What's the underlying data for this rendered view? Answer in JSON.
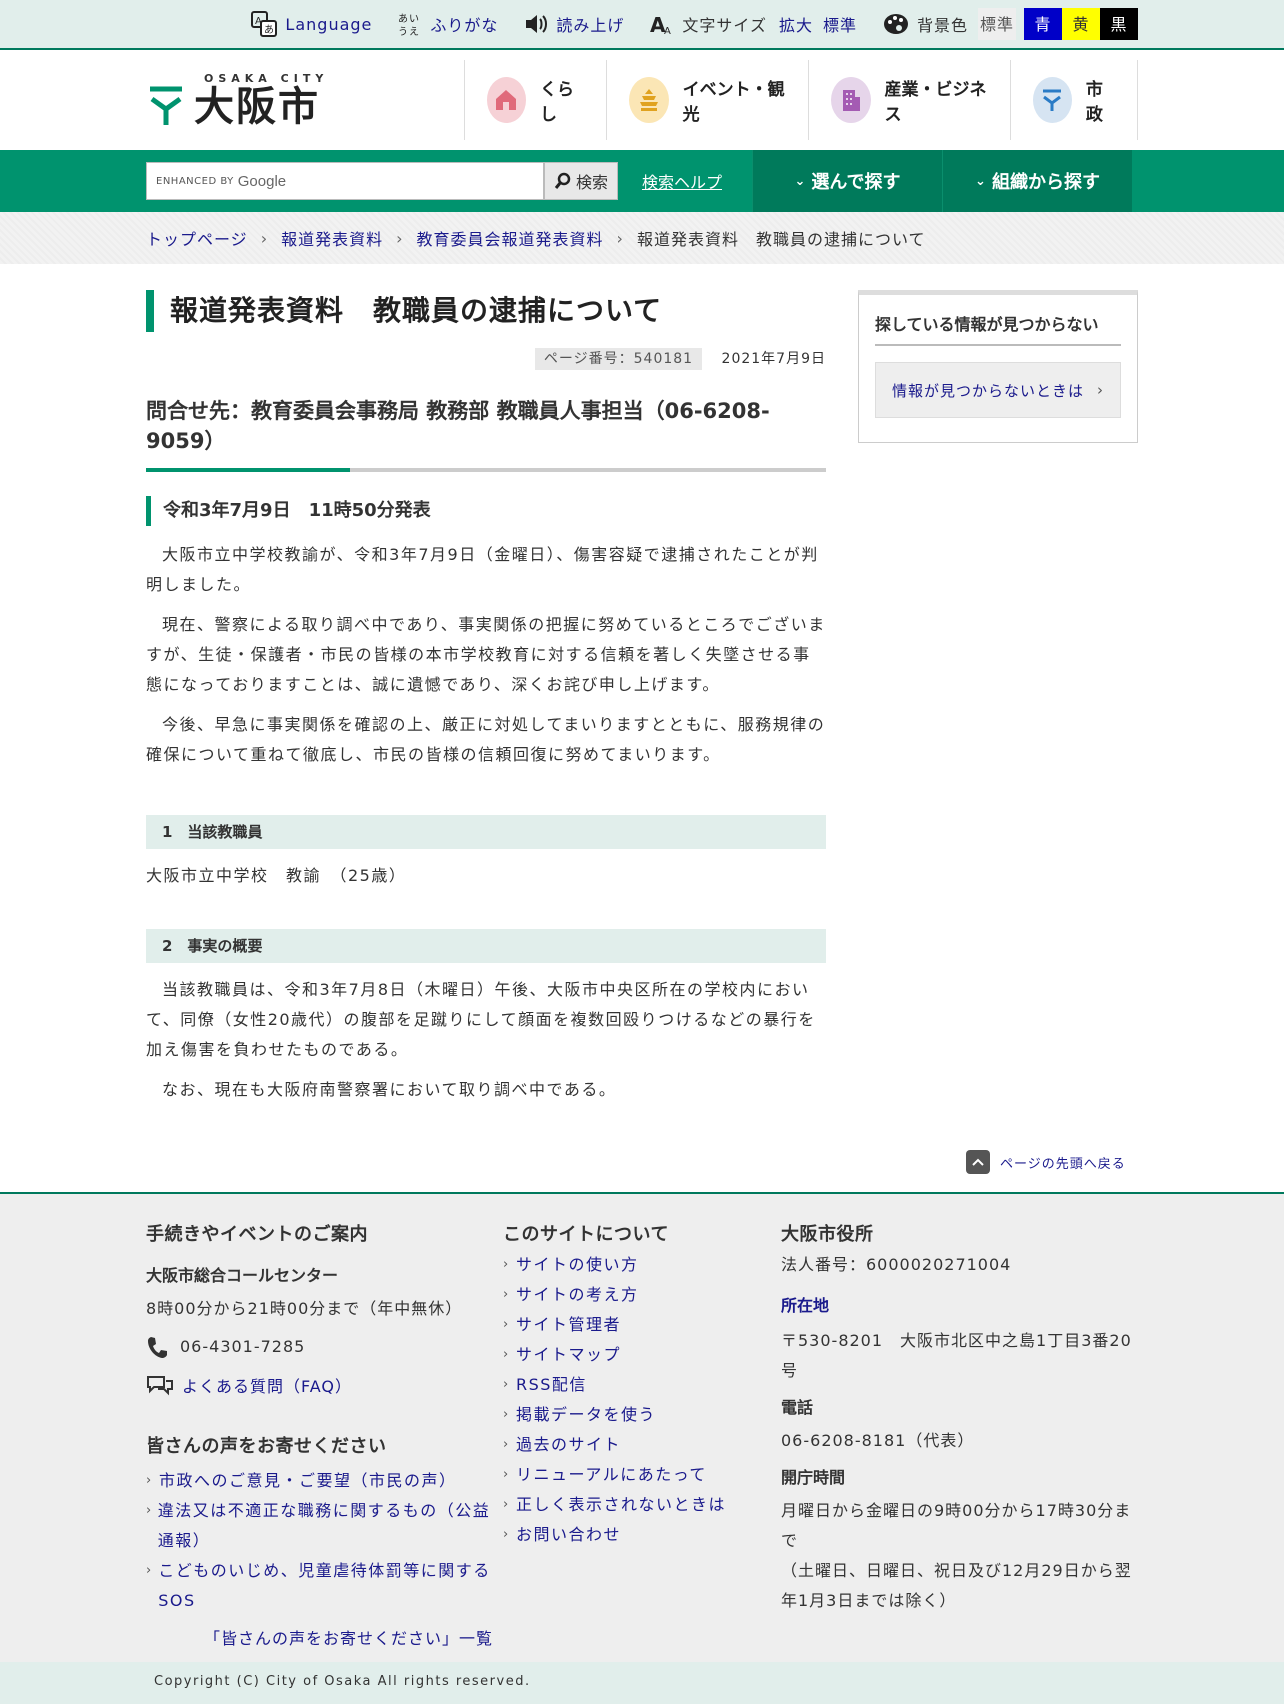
{
  "util": {
    "language": "Language",
    "furigana": "ふりがな",
    "readaloud": "読み上げ",
    "fontsize_label": "文字サイズ",
    "fontsize_large": "拡大",
    "fontsize_std": "標準",
    "bg_label": "背景色",
    "bg_std": "標準",
    "bg_blue": "青",
    "bg_yellow": "黄",
    "bg_black": "黒"
  },
  "logo": {
    "city": "OSAKA CITY",
    "name": "大阪市"
  },
  "gnav": [
    {
      "label": "くらし",
      "color": "#f6d1d6"
    },
    {
      "label": "イベント・観光",
      "color": "#fbe6b5"
    },
    {
      "label": "産業・ビジネス",
      "color": "#e6d5ea"
    },
    {
      "label": "市政",
      "color": "#d6e4f2"
    }
  ],
  "search": {
    "enhanced": "ENHANCED BY",
    "google": "Google",
    "button": "検索",
    "help": "検索ヘルプ",
    "select1": "選んで探す",
    "select2": "組織から探す"
  },
  "breadcrumb": [
    "トップページ",
    "報道発表資料",
    "教育委員会報道発表資料",
    "報道発表資料　教職員の逮捕について"
  ],
  "main": {
    "title": "報道発表資料　教職員の逮捕について",
    "page_no": "ページ番号：540181",
    "date": "2021年7月9日",
    "contact": "問合せ先：教育委員会事務局 教務部 教職員人事担当（06-6208-9059）",
    "release": "令和3年7月9日　11時50分発表",
    "para1": "大阪市立中学校教諭が、令和3年7月9日（金曜日）、傷害容疑で逮捕されたことが判明しました。",
    "para2": "現在、警察による取り調べ中であり、事実関係の把握に努めているところでございますが、生徒・保護者・市民の皆様の本市学校教育に対する信頼を著しく失墜させる事態になっておりますことは、誠に遺憾であり、深くお詫び申し上げます。",
    "para3": "今後、早急に事実関係を確認の上、厳正に対処してまいりますとともに、服務規律の確保について重ねて徹底し、市民の皆様の信頼回復に努めてまいります。",
    "sec1_title": "1　当該教職員",
    "sec1_body": "大阪市立中学校　教諭　（25歳）",
    "sec2_title": "2　事実の概要",
    "sec2_para1": "当該教職員は、令和3年7月8日（木曜日）午後、大阪市中央区所在の学校内において、同僚（女性20歳代）の腹部を足蹴りにして顔面を複数回殴りつけるなどの暴行を加え傷害を負わせたものである。",
    "sec2_para2": "なお、現在も大阪府南警察署において取り調べ中である。"
  },
  "side": {
    "title": "探している情報が見つからない",
    "link": "情報が見つからないときは"
  },
  "pagetop": "ページの先頭へ戻る",
  "footer": {
    "col1": {
      "heading": "手続きやイベントのご案内",
      "center": "大阪市総合コールセンター",
      "hours": "8時00分から21時00分まで（年中無休）",
      "phone": "06-4301-7285",
      "faq": "よくある質問（FAQ）",
      "voice_heading": "皆さんの声をお寄せください",
      "voice_links": [
        "市政へのご意見・ご要望（市民の声）",
        "違法又は不適正な職務に関するもの（公益通報）",
        "こどものいじめ、児童虐待体罰等に関するSOS"
      ],
      "voice_list": "「皆さんの声をお寄せください」一覧"
    },
    "col2": {
      "heading": "このサイトについて",
      "links": [
        "サイトの使い方",
        "サイトの考え方",
        "サイト管理者",
        "サイトマップ",
        "RSS配信",
        "掲載データを使う",
        "過去のサイト",
        "リニューアルにあたって",
        "正しく表示されないときは",
        "お問い合わせ"
      ]
    },
    "col3": {
      "heading": "大阪市役所",
      "corp_no": "法人番号：6000020271004",
      "location_label": "所在地",
      "address": "〒530-8201　大阪市北区中之島1丁目3番20号",
      "tel_label": "電話",
      "tel": "06-6208-8181（代表）",
      "open_label": "開庁時間",
      "open1": "月曜日から金曜日の9時00分から17時30分まで",
      "open2": "（土曜日、日曜日、祝日及び12月29日から翌年1月3日までは除く）"
    }
  },
  "copyright": "Copyright (C) City of Osaka All rights reserved."
}
